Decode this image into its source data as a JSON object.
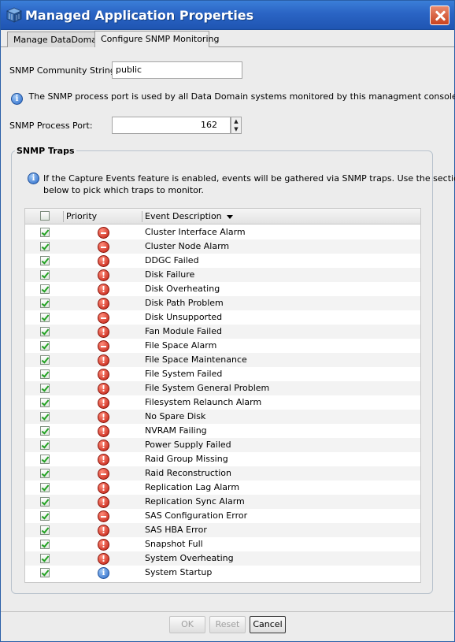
{
  "window": {
    "title": "Managed Application Properties"
  },
  "tabs": [
    {
      "label": "Manage DataDomain",
      "active": false
    },
    {
      "label": "Configure SNMP Monitoring",
      "active": true
    }
  ],
  "form": {
    "community_label": "SNMP Community String:",
    "community_value": "public",
    "info_text": "The SNMP process port is used by all Data Domain systems monitored by this managment console.",
    "port_label": "SNMP Process Port:",
    "port_value": "162"
  },
  "traps": {
    "group_title": "SNMP Traps",
    "info_line1": "If the Capture Events feature is enabled, events will be gathered via SNMP traps. Use the section",
    "info_line2": "below to pick which traps to monitor.",
    "headers": {
      "priority": "Priority",
      "description": "Event Description"
    },
    "rows": [
      {
        "priority": "critical",
        "description": "Cluster Interface Alarm",
        "checked": true
      },
      {
        "priority": "critical",
        "description": "Cluster Node Alarm",
        "checked": true
      },
      {
        "priority": "warning",
        "description": "DDGC Failed",
        "checked": true
      },
      {
        "priority": "warning",
        "description": "Disk Failure",
        "checked": true
      },
      {
        "priority": "warning",
        "description": "Disk Overheating",
        "checked": true
      },
      {
        "priority": "warning",
        "description": "Disk Path Problem",
        "checked": true
      },
      {
        "priority": "critical",
        "description": "Disk Unsupported",
        "checked": true
      },
      {
        "priority": "warning",
        "description": "Fan Module Failed",
        "checked": true
      },
      {
        "priority": "critical",
        "description": "File Space Alarm",
        "checked": true
      },
      {
        "priority": "warning",
        "description": "File Space Maintenance",
        "checked": true
      },
      {
        "priority": "warning",
        "description": "File System Failed",
        "checked": true
      },
      {
        "priority": "warning",
        "description": "File System General Problem",
        "checked": true
      },
      {
        "priority": "warning",
        "description": "Filesystem Relaunch Alarm",
        "checked": true
      },
      {
        "priority": "warning",
        "description": "No Spare Disk",
        "checked": true
      },
      {
        "priority": "warning",
        "description": "NVRAM Failing",
        "checked": true
      },
      {
        "priority": "warning",
        "description": "Power Supply Failed",
        "checked": true
      },
      {
        "priority": "warning",
        "description": "Raid Group Missing",
        "checked": true
      },
      {
        "priority": "critical",
        "description": "Raid Reconstruction",
        "checked": true
      },
      {
        "priority": "warning",
        "description": "Replication Lag Alarm",
        "checked": true
      },
      {
        "priority": "warning",
        "description": "Replication Sync Alarm",
        "checked": true
      },
      {
        "priority": "critical",
        "description": "SAS Configuration Error",
        "checked": true
      },
      {
        "priority": "warning",
        "description": "SAS HBA Error",
        "checked": true
      },
      {
        "priority": "warning",
        "description": "Snapshot Full",
        "checked": true
      },
      {
        "priority": "warning",
        "description": "System Overheating",
        "checked": true
      },
      {
        "priority": "info",
        "description": "System Startup",
        "checked": true
      }
    ]
  },
  "buttons": {
    "ok": "OK",
    "reset": "Reset",
    "cancel": "Cancel"
  }
}
